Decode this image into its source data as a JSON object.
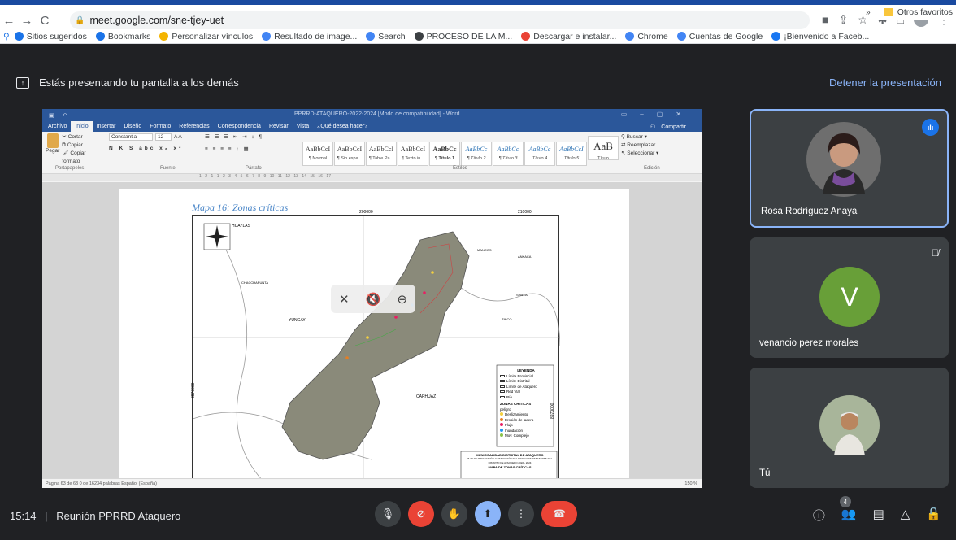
{
  "browser": {
    "url": "meet.google.com/sne-tjey-uet",
    "bookmarks": [
      {
        "label": "Sitios sugeridos",
        "color": "#1a73e8"
      },
      {
        "label": "Bookmarks",
        "color": "#1a73e8"
      },
      {
        "label": "Personalizar vínculos",
        "color": "#f4b400"
      },
      {
        "label": "Resultado de image...",
        "color": "#4285f4"
      },
      {
        "label": "Search",
        "color": "#4285f4"
      },
      {
        "label": "PROCESO DE LA M...",
        "color": "#3c4043"
      },
      {
        "label": "Descargar e instalar...",
        "color": "#ea4335"
      },
      {
        "label": "Chrome",
        "color": "#4285f4"
      },
      {
        "label": "Cuentas de Google",
        "color": "#4285f4"
      },
      {
        "label": "¡Bienvenido a Faceb...",
        "color": "#1877f2"
      }
    ],
    "more": "»",
    "other_favorites": "Otros favoritos"
  },
  "presenting": {
    "message": "Estás presentando tu pantalla a los demás",
    "stop_label": "Detener la presentación"
  },
  "word": {
    "title": "PPRRD-ATAQUERO-2022-2024 [Modo de compatibilidad] - Word",
    "tabs": [
      "Archivo",
      "Inicio",
      "Insertar",
      "Diseño",
      "Formato",
      "Referencias",
      "Correspondencia",
      "Revisar",
      "Vista",
      "¿Qué desea hacer?"
    ],
    "share": "Compartir",
    "clipboard": {
      "paste": "Pegar",
      "cut": "Cortar",
      "copy": "Copiar",
      "format": "Copiar formato",
      "group": "Portapapeles"
    },
    "font": {
      "name": "Constantia",
      "size": "12",
      "group": "Fuente"
    },
    "paragraph_group": "Párrafo",
    "styles": [
      {
        "sample": "AaBbCcI",
        "name": "¶ Normal"
      },
      {
        "sample": "AaBbCcI",
        "name": "¶ Sin espa..."
      },
      {
        "sample": "AaBbCcI",
        "name": "¶ Table Pa..."
      },
      {
        "sample": "AaBbCcI",
        "name": "¶ Texto in..."
      },
      {
        "sample": "AaBbCc",
        "name": "¶ Título 1"
      },
      {
        "sample": "AaBbCc",
        "name": "¶ Título 2"
      },
      {
        "sample": "AaBbCc",
        "name": "¶ Título 3"
      },
      {
        "sample": "AaBbCc",
        "name": "Título 4"
      },
      {
        "sample": "AaBbCcI",
        "name": "Título 5"
      },
      {
        "sample": "AaB",
        "name": "Título"
      }
    ],
    "styles_group": "Estilos",
    "editing": {
      "find": "Buscar",
      "replace": "Reemplazar",
      "select": "Seleccionar",
      "group": "Edición"
    },
    "ruler": "· 1 · 2 · 1 · 1 · 2 · 3 · 4 · 5 · 6 · 7 · 8 · 9 · 10 · 11 · 12 · 13 · 14 · 15 · 16 · 17",
    "map_title": "Mapa 16: Zonas críticas",
    "map": {
      "coord_top_left": "200000",
      "coord_top_right": "210000",
      "coord_left": "8970000",
      "coord_right": "8970000",
      "places": [
        "HUAYLAS",
        "YUNGAY",
        "CARHUAZ",
        "MANCOS",
        "SHILLA",
        "TINCO",
        "ANKACA",
        "CHACCHAPUNTA"
      ],
      "legend_title": "LEYENDA",
      "legend_items": [
        "Límite Provincial",
        "Límite Distrital",
        "Límite de Ataquero",
        "Red Vial",
        "Río"
      ],
      "critical_title": "ZONAS CRITICAS",
      "critical_sub": "peligro",
      "critical_items": [
        {
          "label": "Deslizamiento",
          "color": "#f4d03f"
        },
        {
          "label": "Erosión de ladera",
          "color": "#e67e22"
        },
        {
          "label": "Flujo",
          "color": "#e91e63"
        },
        {
          "label": "Inundación",
          "color": "#2196f3"
        },
        {
          "label": "Mov. Complejo",
          "color": "#8bc34a"
        }
      ],
      "block_title": "MUNICIPALIDAD DISTRITAL DE ATAQUERO",
      "block_sub": "PLAN DE PREVENCIÓN Y REDUCCIÓN DEL RIESGO DE DESASTRES DEL DISTRITO DE ATAQUERO 2022 - 2024",
      "block_map": "MAPA DE ZONAS CRÍTICAS"
    },
    "status": "Página 63 de 63    0 de 16234 palabras    Español (España)",
    "zoom": "150 %"
  },
  "participants": [
    {
      "name": "Rosa Rodríguez Anaya",
      "state": "speaking"
    },
    {
      "name": "venancio perez morales",
      "initial": "V",
      "color": "#689f38",
      "state": "muted"
    },
    {
      "name": "Tú",
      "state": "self"
    }
  ],
  "meeting": {
    "time": "15:14",
    "separator": "|",
    "name": "Reunión PPRRD Ataquero",
    "participant_count": "4"
  }
}
